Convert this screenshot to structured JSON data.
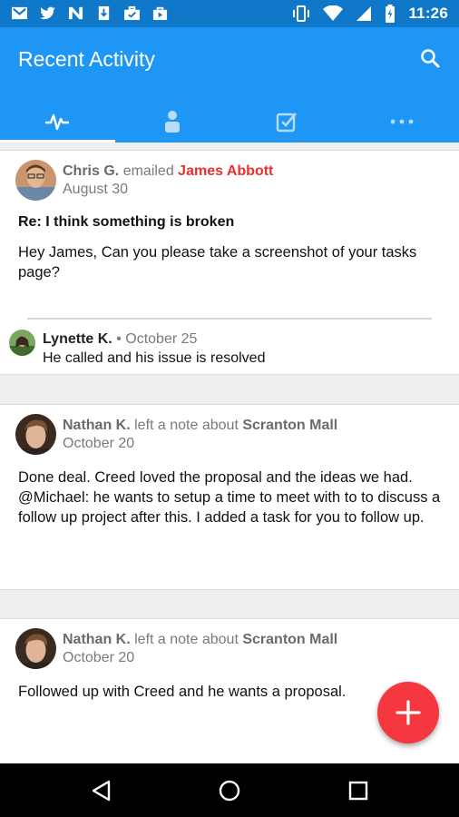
{
  "status_bar": {
    "time": "11:26",
    "left_icons": [
      "gmail-icon",
      "twitter-icon",
      "nordvpn-icon",
      "download-icon",
      "briefcase-icon",
      "shopping-bag-icon"
    ],
    "right_icons": [
      "vibrate-icon",
      "wifi-icon",
      "signal-icon",
      "battery-icon"
    ]
  },
  "app_bar": {
    "title": "Recent Activity",
    "tabs": [
      {
        "icon": "activity-pulse-icon",
        "active": true
      },
      {
        "icon": "person-icon",
        "active": false
      },
      {
        "icon": "checkbox-icon",
        "active": false
      },
      {
        "icon": "more-dots-icon",
        "active": false
      }
    ]
  },
  "colors": {
    "status_bar": "#0f78c9",
    "app_bar": "#1e96f5",
    "accent_red": "#e8322f",
    "fab": "#f5373f"
  },
  "feed": [
    {
      "author": "Chris G.",
      "action": "emailed",
      "target": "James Abbott",
      "date": "August 30",
      "subject": "Re: I think something is broken",
      "body": "Hey James,  Can you please take a screenshot of your tasks page?",
      "comment": {
        "author": "Lynette K.",
        "separator": "•",
        "date": "October 25",
        "text": "He called and his issue is resolved"
      }
    },
    {
      "author": "Nathan K.",
      "action": "left a note about",
      "target": "Scranton Mall",
      "date": "October 20",
      "body": "Done deal. Creed loved the proposal and the ideas we had. @Michael: he wants to setup a time to meet with to to discuss a follow up project after this. I added a task for you to follow up."
    },
    {
      "author": "Nathan K.",
      "action": "left a note about",
      "target": "Scranton Mall",
      "date": "October 20",
      "body": "Followed up with Creed and he wants a proposal."
    }
  ],
  "fab": {
    "icon": "plus-icon"
  },
  "nav_bar": {
    "buttons": [
      "back-icon",
      "home-icon",
      "recents-icon"
    ]
  }
}
